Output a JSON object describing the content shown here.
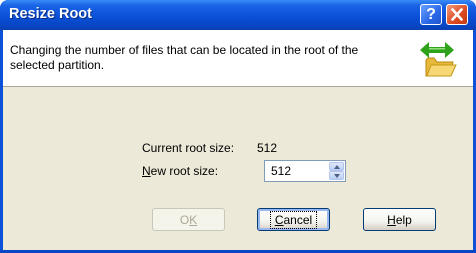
{
  "window": {
    "title": "Resize Root",
    "help_glyph": "?",
    "close_glyph": "close-icon"
  },
  "header": {
    "description": "Changing the number of files that can be located in the root of the selected partition.",
    "icon": "folder-resize-icon"
  },
  "form": {
    "current_root_label": "Current root size:",
    "current_root_value": "512",
    "new_root_label_accel": "N",
    "new_root_label_rest": "ew root size:",
    "new_root_value": "512"
  },
  "buttons": {
    "ok_pre": "O",
    "ok_accel": "K",
    "cancel_accel": "C",
    "cancel_rest": "ancel",
    "help_accel": "H",
    "help_rest": "elp"
  },
  "colors": {
    "titlebar": "#0a50d8",
    "dialog_face": "#ece9d8",
    "header_bg": "#ffffff",
    "arrow_green": "#2ea21a",
    "folder_yellow": "#f2c94c"
  }
}
